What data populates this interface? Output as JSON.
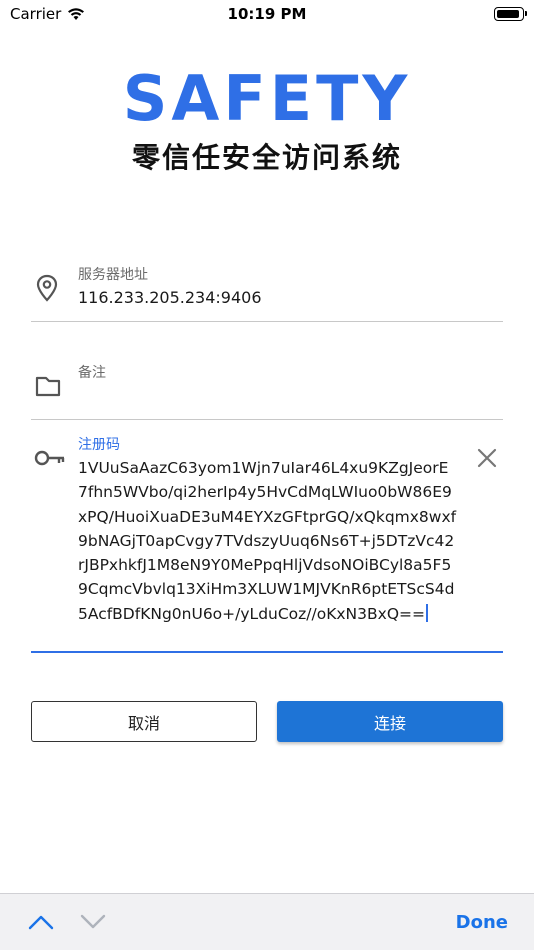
{
  "status_bar": {
    "carrier": "Carrier",
    "time": "10:19 PM"
  },
  "header": {
    "logo": "SAFETY",
    "subtitle": "零信任安全访问系统"
  },
  "form": {
    "server": {
      "label": "服务器地址",
      "value": "116.233.205.234:9406",
      "icon": "location-pin-icon"
    },
    "note": {
      "label": "备注",
      "value": "",
      "icon": "folder-icon"
    },
    "registration": {
      "label": "注册码",
      "value": "1VUuSaAazC63yom1Wjn7uIar46L4xu9KZgJeorE7fhn5WVbo/qi2herIp4y5HvCdMqLWIuo0bW86E9xPQ/HuoiXuaDE3uM4EYXzGFtprGQ/xQkqmx8wxf9bNAGjT0apCvgy7TVdszyUuq6Ns6T+j5DTzVc42rJBPxhkfJ1M8eN9Y0MePpqHljVdsoNOiBCyl8a5F59CqmcVbvlq13XiHm3XLUW1MJVKnR6ptETScS4d5AcfBDfKNg0nU6o+/yLduCoz//oKxN3BxQ==",
      "icon": "key-icon"
    }
  },
  "buttons": {
    "cancel": "取消",
    "connect": "连接"
  },
  "keyboard_toolbar": {
    "done": "Done"
  },
  "colors": {
    "accent": "#2f6fe6",
    "primary_button": "#1e74d6"
  }
}
